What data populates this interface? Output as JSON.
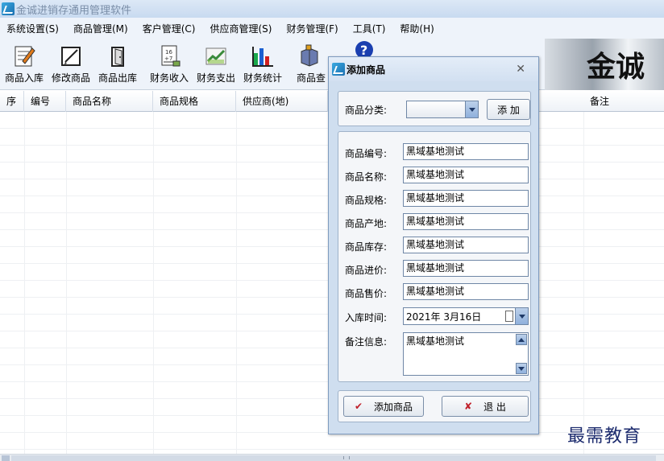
{
  "window": {
    "title": "金诚进销存通用管理软件"
  },
  "menu": [
    "系统设置(S)",
    "商品管理(M)",
    "客户管理(C)",
    "供应商管理(S)",
    "财务管理(F)",
    "工具(T)",
    "帮助(H)"
  ],
  "toolbar": {
    "buttons": [
      {
        "label": "商品入库",
        "icon": "stock-in-icon"
      },
      {
        "label": "修改商品",
        "icon": "edit-product-icon"
      },
      {
        "label": "商品出库",
        "icon": "stock-out-icon"
      },
      {
        "label": "财务收入",
        "icon": "income-calculator-icon"
      },
      {
        "label": "财务支出",
        "icon": "expense-chart-icon"
      },
      {
        "label": "财务统计",
        "icon": "statistics-bar-icon"
      },
      {
        "label": "商品查",
        "icon": "product-search-icon"
      }
    ],
    "banner_text": "金诚"
  },
  "grid": {
    "columns": [
      "序",
      "编号",
      "商品名称",
      "商品规格",
      "供应商(地)",
      "备注"
    ]
  },
  "dialog": {
    "title": "添加商品",
    "category_label": "商品分类:",
    "category_value": "",
    "add_button": "添 加",
    "fields": [
      {
        "label": "商品编号:",
        "value": "黑域基地测试"
      },
      {
        "label": "商品名称:",
        "value": "黑域基地测试"
      },
      {
        "label": "商品规格:",
        "value": "黑域基地测试"
      },
      {
        "label": "商品产地:",
        "value": "黑域基地测试"
      },
      {
        "label": "商品库存:",
        "value": "黑域基地测试"
      },
      {
        "label": "商品进价:",
        "value": "黑域基地测试"
      },
      {
        "label": "商品售价:",
        "value": "黑域基地测试"
      }
    ],
    "date_label": "入库时间:",
    "date_value": "2021年  3月16日",
    "memo_label": "备注信息:",
    "memo_value": "黑域基地测试",
    "submit_button": "添加商品",
    "exit_button": "退   出"
  },
  "watermark": "最需教育",
  "colors": {
    "accent": "#1a6fb0",
    "dialog_bg": "#cfdeef"
  }
}
